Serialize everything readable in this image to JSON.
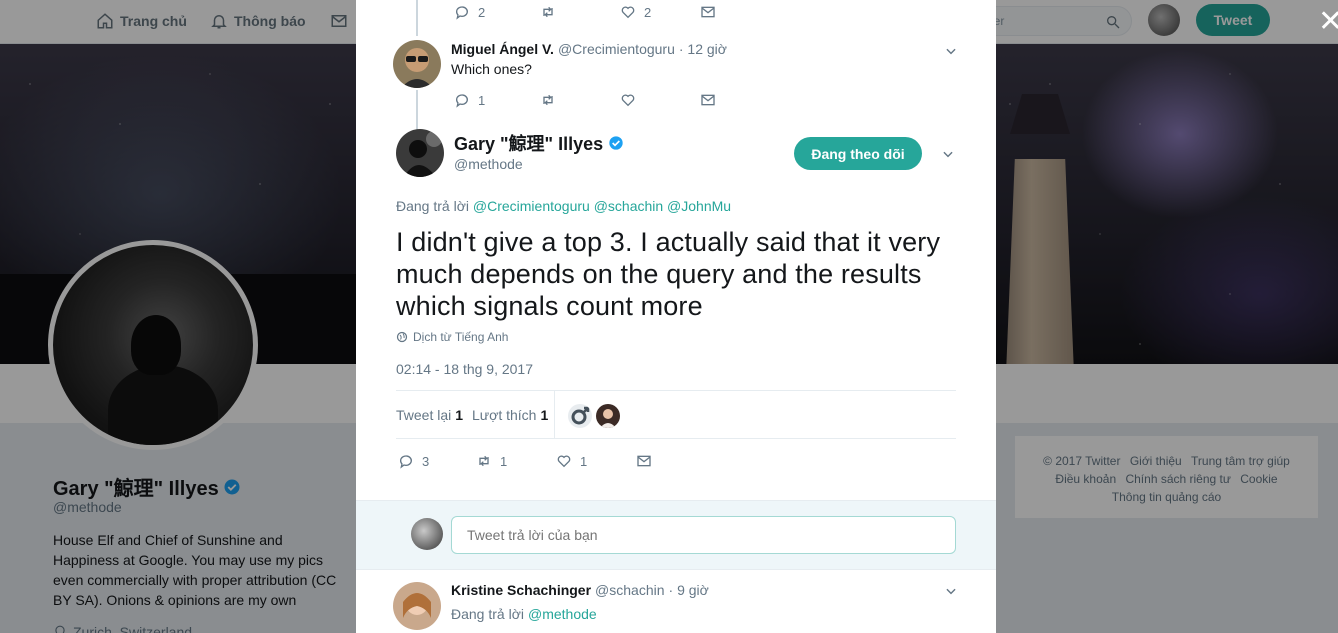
{
  "nav": {
    "home": "Trang chủ",
    "notifications": "Thông báo",
    "search_placeholder": "tter",
    "tweet_button": "Tweet",
    "close": "✕"
  },
  "profile": {
    "name": "Gary \"鯨理\" Illyes",
    "handle": "@methode",
    "bio": "House Elf and Chief of Sunshine and Happiness at Google. You may use my pics even commercially with proper attribution (CC BY SA). Onions & opinions are my own",
    "location": "Zurich, Switzerland"
  },
  "footer": {
    "links": [
      "© 2017 Twitter",
      "Giới thiệu",
      "Trung tâm trợ giúp",
      "Điều khoản",
      "Chính sách riêng tư",
      "Cookie",
      "Thông tin quảng cáo"
    ]
  },
  "thread": {
    "prev_tweet_actions": {
      "replies": "2",
      "retweets": "",
      "likes": "2"
    },
    "miguel": {
      "name": "Miguel Ángel V.",
      "handle": "@Crecimientoguru",
      "time": "· 12 giờ",
      "text": "Which ones?",
      "replies": "1",
      "retweets": "",
      "likes": ""
    },
    "main": {
      "name": "Gary \"鯨理\" Illyes",
      "handle": "@methode",
      "follow_label": "Đang theo dõi",
      "reply_prefix": "Đang trả lời",
      "reply_mentions": "@Crecimientoguru @schachin @JohnMu",
      "text": "I didn't give a top 3. I actually said that it very much depends on the query and the results which signals count more",
      "translate": "Dịch từ Tiếng Anh",
      "timestamp": "02:14 - 18 thg 9, 2017",
      "retweets_label": "Tweet lại",
      "retweets_count": "1",
      "likes_label": "Lượt thích",
      "likes_count": "1",
      "replies": "3",
      "rt": "1",
      "lk": "1"
    },
    "reply_placeholder": "Tweet trả lời của bạn",
    "kristine": {
      "name": "Kristine Schachinger",
      "handle": "@schachin",
      "time": "· 9 giờ",
      "reply_prefix": "Đang trả lời",
      "reply_mention": "@methode"
    }
  },
  "colors": {
    "accent": "#26a69a",
    "verified": "#1da1f2",
    "muted": "#657786"
  }
}
